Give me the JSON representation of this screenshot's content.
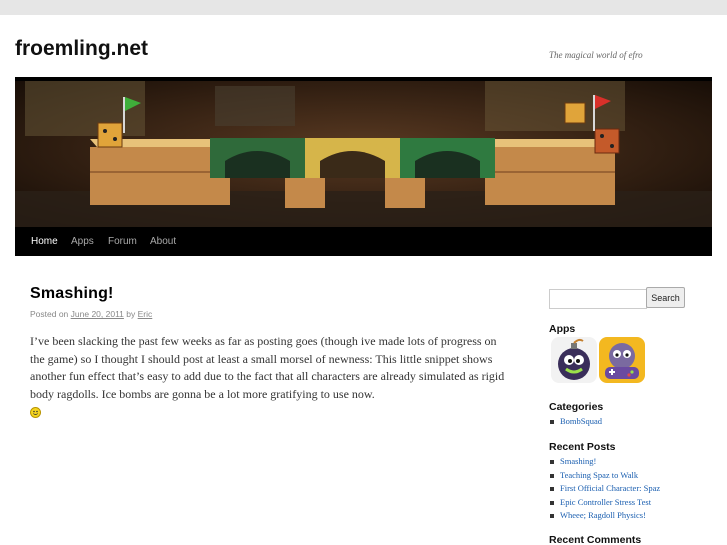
{
  "site": {
    "title": "froemling.net",
    "description": "The magical world of efro"
  },
  "nav": {
    "items": [
      "Home",
      "Apps",
      "Forum",
      "About"
    ],
    "current": "Home"
  },
  "post": {
    "title": "Smashing!",
    "posted_on_label": "Posted on",
    "date": "June 20, 2011",
    "by_label": "by",
    "author": "Eric",
    "body": "I’ve been slacking the past few weeks as far as posting goes (though ive made lots of progress on the game) so I thought I should post at least a small morsel of newness:  This little snippet shows another fun effect that’s easy to add due to the fact that all characters are already simulated as rigid body ragdolls.  Ice bombs are gonna be a lot more gratifying to use now."
  },
  "sidebar": {
    "search_button": "Search",
    "search_value": "",
    "apps_heading": "Apps",
    "apps_icons": [
      "bomb-squad-app-icon",
      "bomb-squad-remote-app-icon"
    ],
    "categories_heading": "Categories",
    "categories": [
      "BombSquad"
    ],
    "recent_posts_heading": "Recent Posts",
    "recent_posts": [
      "Smashing!",
      "Teaching Spaz to Walk",
      "First Official Character: Spaz",
      "Epic Controller Stress Test",
      "Wheee; Ragdoll Physics!"
    ],
    "recent_comments_heading": "Recent Comments"
  },
  "colors": {
    "link": "#1b5fb0",
    "nav_bg": "#000000",
    "page_bg": "#e6e6e6"
  }
}
